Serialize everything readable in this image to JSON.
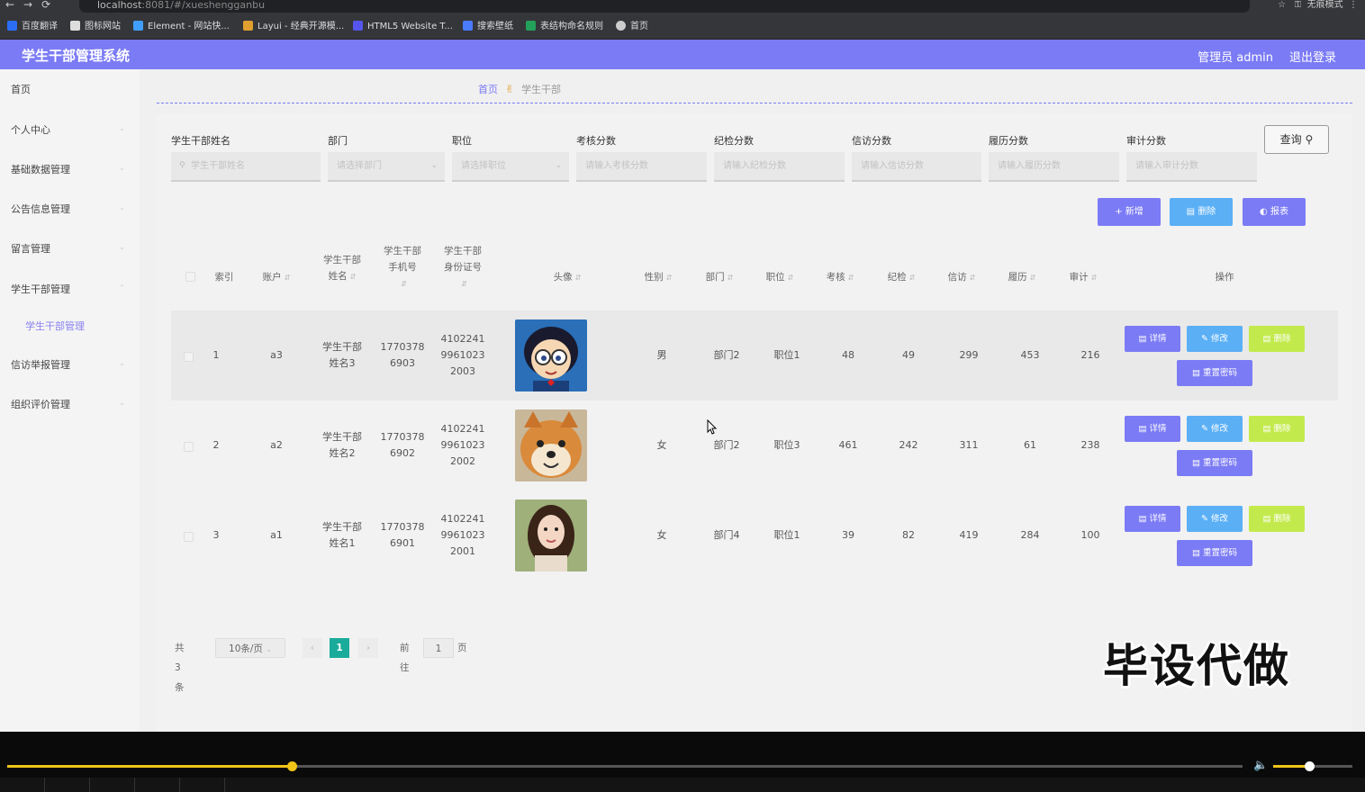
{
  "browser": {
    "url_host": "localhost",
    "url_path": ":8081/#/xueshengganbu",
    "mode_label": "无痕模式",
    "bookmarks": [
      {
        "label": "百度翻译",
        "color": "#2b6ef5"
      },
      {
        "label": "图标网站",
        "color": "#ffffff"
      },
      {
        "label": "Element - 网站快...",
        "color": "#409eff"
      },
      {
        "label": "Layui - 经典开源模...",
        "color": "#e0a030"
      },
      {
        "label": "HTML5 Website T...",
        "color": "#5555ee"
      },
      {
        "label": "搜索壁纸",
        "color": "#4a7bff"
      },
      {
        "label": "表结构命名规则",
        "color": "#23a05a"
      },
      {
        "label": "首页",
        "color": "#cccccc"
      }
    ]
  },
  "header": {
    "title": "学生干部管理系统",
    "admin": "管理员 admin",
    "logout": "退出登录"
  },
  "sidebar": {
    "items": [
      "首页",
      "个人中心",
      "基础数据管理",
      "公告信息管理",
      "留言管理",
      "学生干部管理",
      "信访举报管理",
      "组织评价管理"
    ],
    "active_sub": "学生干部管理"
  },
  "breadcrumb": {
    "home": "首页",
    "current": "学生干部"
  },
  "filters": {
    "name": {
      "label": "学生干部姓名",
      "placeholder": "学生干部姓名"
    },
    "dept": {
      "label": "部门",
      "placeholder": "请选择部门"
    },
    "position": {
      "label": "职位",
      "placeholder": "请选择职位"
    },
    "exam": {
      "label": "考核分数",
      "placeholder": "请输入考核分数"
    },
    "discipline": {
      "label": "纪检分数",
      "placeholder": "请输入纪检分数"
    },
    "petition": {
      "label": "信访分数",
      "placeholder": "请输入信访分数"
    },
    "resume": {
      "label": "履历分数",
      "placeholder": "请输入履历分数"
    },
    "audit": {
      "label": "审计分数",
      "placeholder": "请输入审计分数"
    },
    "query": "查询"
  },
  "actions": {
    "add": "新增",
    "delete": "删除",
    "report": "报表"
  },
  "table": {
    "headers": {
      "index": "索引",
      "account": "账户",
      "name_1": "学生干部",
      "name_2": "姓名",
      "phone_1": "学生干部",
      "phone_2": "手机号",
      "idcard_1": "学生干部",
      "idcard_2": "身份证号",
      "avatar": "头像",
      "gender": "性别",
      "dept": "部门",
      "position": "职位",
      "exam": "考核",
      "discipline": "纪检",
      "petition": "信访",
      "resume": "履历",
      "audit": "审计",
      "ops": "操作"
    },
    "rows": [
      {
        "index": "1",
        "account": "a3",
        "name_1": "学生干部",
        "name_2": "姓名3",
        "phone_1": "1770378",
        "phone_2": "6903",
        "id_1": "4102241",
        "id_2": "9961023",
        "id_3": "2003",
        "avatar": "cartoon-boy",
        "gender": "男",
        "dept": "部门2",
        "position": "职位1",
        "exam": "48",
        "discipline": "49",
        "petition": "299",
        "resume": "453",
        "audit": "216"
      },
      {
        "index": "2",
        "account": "a2",
        "name_1": "学生干部",
        "name_2": "姓名2",
        "phone_1": "1770378",
        "phone_2": "6902",
        "id_1": "4102241",
        "id_2": "9961023",
        "id_3": "2002",
        "avatar": "shiba-dog",
        "gender": "女",
        "dept": "部门2",
        "position": "职位3",
        "exam": "461",
        "discipline": "242",
        "petition": "311",
        "resume": "61",
        "audit": "238"
      },
      {
        "index": "3",
        "account": "a1",
        "name_1": "学生干部",
        "name_2": "姓名1",
        "phone_1": "1770378",
        "phone_2": "6901",
        "id_1": "4102241",
        "id_2": "9961023",
        "id_3": "2001",
        "avatar": "portrait-girl",
        "gender": "女",
        "dept": "部门4",
        "position": "职位1",
        "exam": "39",
        "discipline": "82",
        "petition": "419",
        "resume": "284",
        "audit": "100"
      }
    ],
    "op_labels": {
      "detail": "详情",
      "edit": "修改",
      "delete": "删除",
      "reset": "重置密码"
    }
  },
  "pagination": {
    "total": "共 3 条",
    "page_size": "10条/页",
    "current": "1",
    "goto_label": "前往",
    "goto_value": "1",
    "page_unit": "页"
  },
  "watermark": "毕设代做",
  "video": {
    "progress": 0.23,
    "volume": 0.45
  },
  "colors": {
    "header": "#7b7bf5",
    "accent": "#7b7bf5",
    "edit": "#5aaff5",
    "delete": "#c3ea4c",
    "pager_active": "#1aab9b",
    "seek": "#f0c419"
  }
}
